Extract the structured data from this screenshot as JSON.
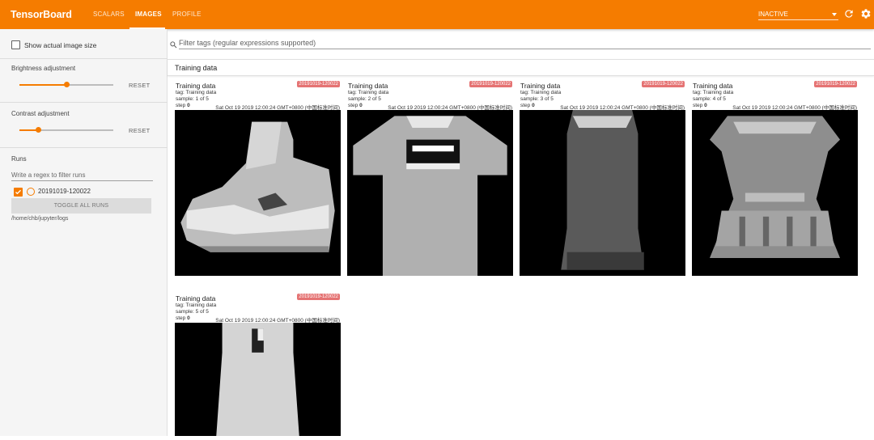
{
  "topbar": {
    "brand": "TensorBoard",
    "tabs": [
      {
        "label": "SCALARS",
        "active": false
      },
      {
        "label": "IMAGES",
        "active": true
      },
      {
        "label": "PROFILE",
        "active": false
      }
    ],
    "status_select": "INACTIVE",
    "icons": [
      "refresh-icon",
      "settings-icon"
    ],
    "accent_color": "#f57c00"
  },
  "sidebar": {
    "show_actual_size_label": "Show actual image size",
    "brightness": {
      "label": "Brightness adjustment",
      "value": 0.5,
      "reset_label": "RESET"
    },
    "contrast": {
      "label": "Contrast adjustment",
      "value": 0.2,
      "reset_label": "RESET"
    },
    "runs": {
      "title": "Runs",
      "filter_placeholder": "Write a regex to filter runs",
      "items": [
        {
          "name": "20191019-120022",
          "checked": true
        }
      ],
      "toggle_label": "TOGGLE ALL RUNS",
      "logdir": "/home/chb/jupyter/logs"
    }
  },
  "main": {
    "filter_placeholder": "Filter tags (regular expressions supported)",
    "group_title": "Training data",
    "cards": [
      {
        "title": "Training data",
        "run": "20191019-120022",
        "tag": "tag: Training data",
        "sample": "sample: 1 of 5",
        "step_label": "step",
        "step_value": "0",
        "time": "Sat Oct 19 2019 12:00:24 GMT+0800 (中国标准时间)",
        "image": "ankle-boot"
      },
      {
        "title": "Training data",
        "run": "20191019-120022",
        "tag": "tag: Training data",
        "sample": "sample: 2 of 5",
        "step_label": "step",
        "step_value": "0",
        "time": "Sat Oct 19 2019 12:00:24 GMT+0800 (中国标准时间)",
        "image": "t-shirt"
      },
      {
        "title": "Training data",
        "run": "20191019-120022",
        "tag": "tag: Training data",
        "sample": "sample: 3 of 5",
        "step_label": "step",
        "step_value": "0",
        "time": "Sat Oct 19 2019 12:00:24 GMT+0800 (中国标准时间)",
        "image": "dress-dark"
      },
      {
        "title": "Training data",
        "run": "20191019-120022",
        "tag": "tag: Training data",
        "sample": "sample: 4 of 5",
        "step_label": "step",
        "step_value": "0",
        "time": "Sat Oct 19 2019 12:00:24 GMT+0800 (中国标准时间)",
        "image": "dress-patterned"
      },
      {
        "title": "Training data",
        "run": "20191019-120022",
        "tag": "tag: Training data",
        "sample": "sample: 5 of 5",
        "step_label": "step",
        "step_value": "0",
        "time": "Sat Oct 19 2019 12:00:24 GMT+0800 (中国标准时间)",
        "image": "dress-light"
      }
    ]
  }
}
